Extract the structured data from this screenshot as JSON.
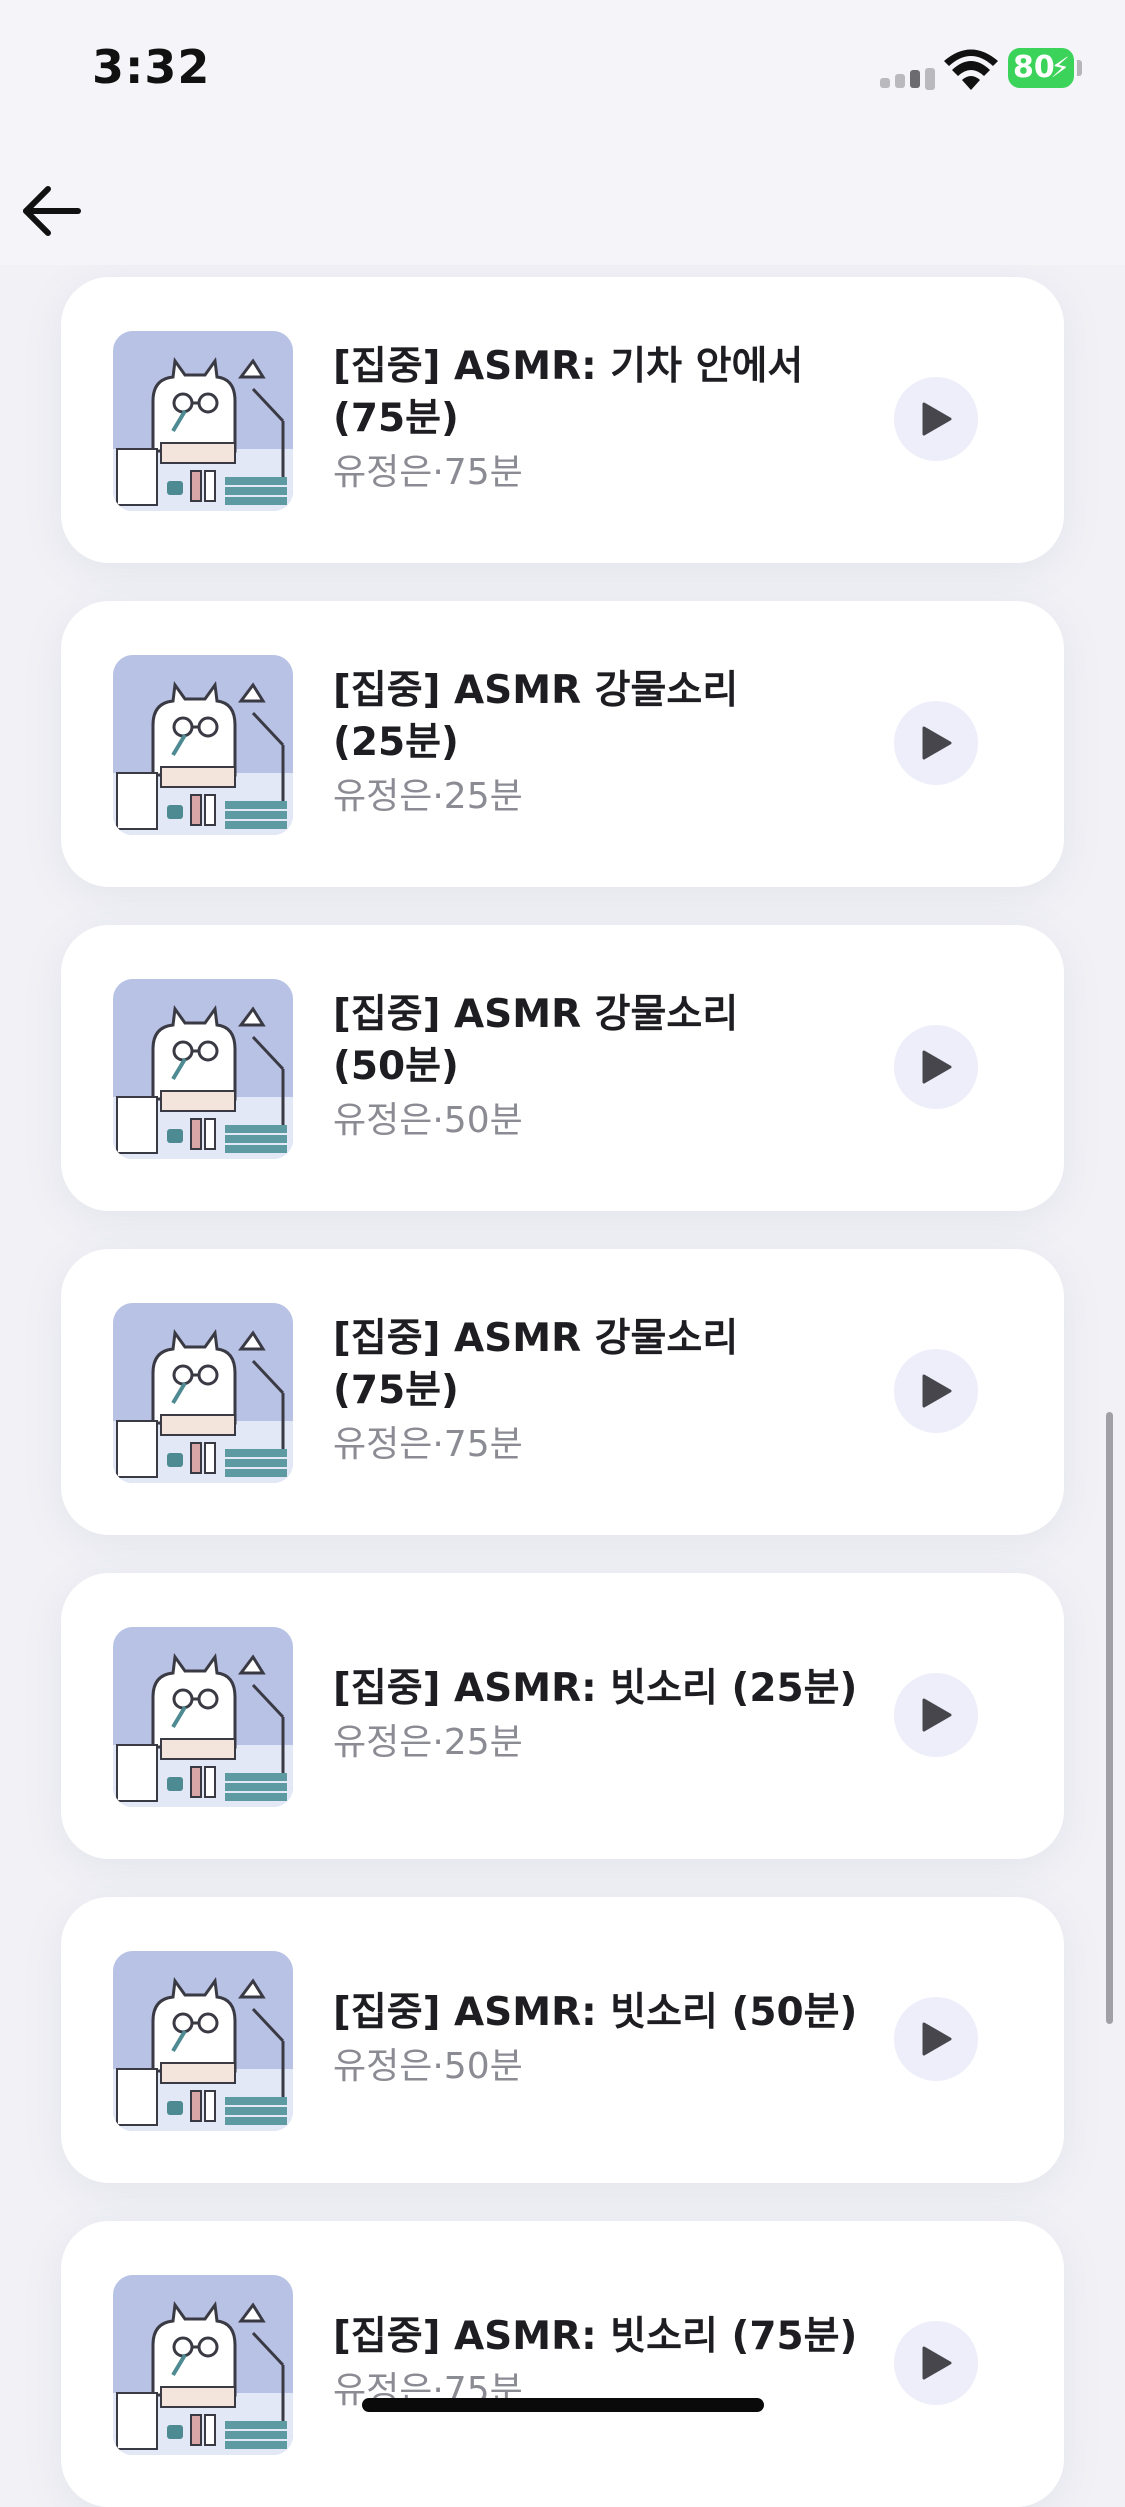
{
  "status_bar": {
    "time": "3:32",
    "battery_level": "80",
    "battery_color": "#3bd359"
  },
  "nav": {
    "back_icon": "arrow-left-icon"
  },
  "accent": {
    "play_button_bg": "#eeeefa",
    "play_icon_color": "#46464c"
  },
  "tracks": [
    {
      "title_line1": "[집중] ASMR: 기차 안에서",
      "title_line2": "(75분)",
      "subtitle": "유정은·75분"
    },
    {
      "title_line1": "[집중] ASMR 강물소리",
      "title_line2": "(25분)",
      "subtitle": "유정은·25분"
    },
    {
      "title_line1": "[집중] ASMR 강물소리",
      "title_line2": "(50분)",
      "subtitle": "유정은·50분"
    },
    {
      "title_line1": "[집중] ASMR 강물소리",
      "title_line2": "(75분)",
      "subtitle": "유정은·75분"
    },
    {
      "title_line1": "[집중] ASMR: 빗소리 (25분)",
      "title_line2": "",
      "subtitle": "유정은·25분"
    },
    {
      "title_line1": "[집중] ASMR: 빗소리 (50분)",
      "title_line2": "",
      "subtitle": "유정은·50분"
    },
    {
      "title_line1": "[집중] ASMR: 빗소리 (75분)",
      "title_line2": "",
      "subtitle": "유정은·75분"
    }
  ]
}
